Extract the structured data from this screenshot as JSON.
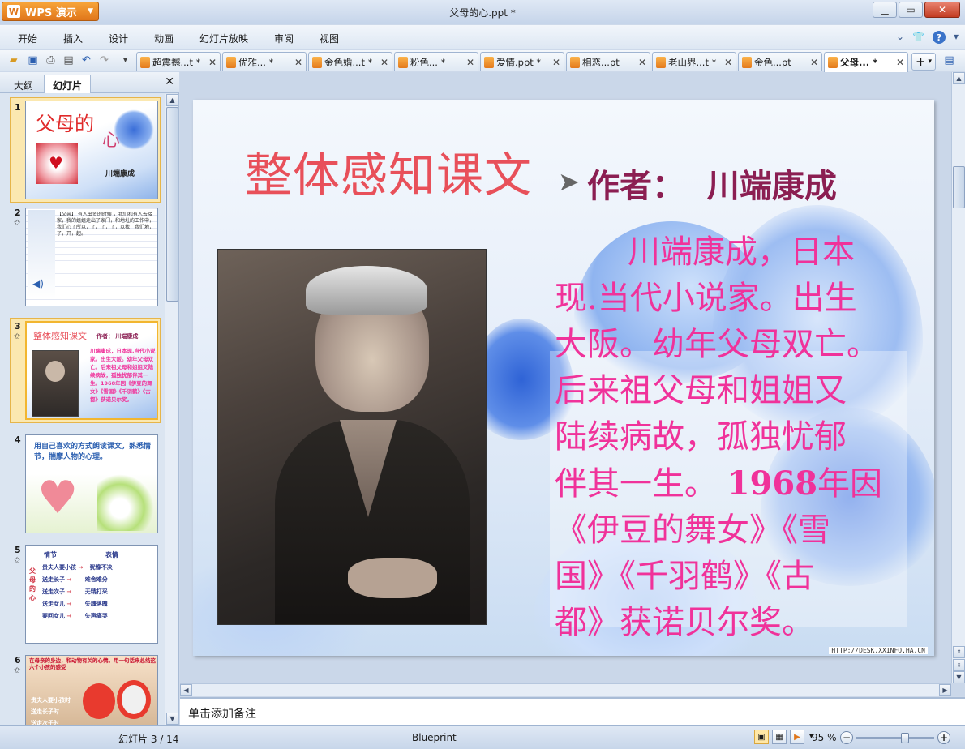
{
  "app": {
    "button_label": "WPS 演示",
    "logo_letter": "W",
    "window_title": "父母的心.ppt *"
  },
  "window_controls": {
    "minimize": "▭",
    "maximize": "▢",
    "close": "✕"
  },
  "menu": {
    "items": [
      "开始",
      "插入",
      "设计",
      "动画",
      "幻灯片放映",
      "审阅",
      "视图"
    ]
  },
  "tabs": [
    {
      "label": "超震撼...t *"
    },
    {
      "label": "优雅... *"
    },
    {
      "label": "金色婚...t *"
    },
    {
      "label": "粉色... *"
    },
    {
      "label": "爱情.ppt *"
    },
    {
      "label": "相恋...pt"
    },
    {
      "label": "老山界...t *"
    },
    {
      "label": "金色...pt"
    },
    {
      "label": "父母... *"
    }
  ],
  "left_panel": {
    "tab_outline": "大纲",
    "tab_slides": "幻灯片",
    "thumbnails": [
      {
        "num": "1",
        "title": "父母的",
        "extra": "心",
        "sub": "川端康成"
      },
      {
        "num": "2",
        "text": "【父亲】 有人出资的时候 ，我们和有人去接家，我的姐姐走出了家门，和地址的工作中，我们心了所以，了，了，了，以找，我们地，了，开，起。"
      },
      {
        "num": "3",
        "title": "整体感知课文",
        "author": "作者： 川端康成",
        "body": "川端康成，日本现.当代小说家。出生大阪。幼年父母双亡。后来祖父母和姐姐又陆续病故，孤独忧郁伴其一生。1968年因《伊豆的舞女》《雪国》《千羽鹤》《古都》获诺贝尔奖。"
      },
      {
        "num": "4",
        "text": "用自己喜欢的方式朗读课文，熟悉情节，揣摩人物的心理。"
      },
      {
        "num": "5",
        "col1": "情节",
        "col2": "表情",
        "side": "父母的心",
        "rows": [
          {
            "a": "贵夫人要小孩",
            "b": "犹豫不决"
          },
          {
            "a": "送走长子",
            "b": "难舍难分"
          },
          {
            "a": "送走次子",
            "b": "无精打采"
          },
          {
            "a": "送走女儿",
            "b": "失魂落魄"
          },
          {
            "a": "要回女儿",
            "b": "失声痛哭"
          }
        ]
      },
      {
        "num": "6",
        "text": "在母亲的身边，和动物有关的心情。用一句话来总结这六个小孩的感受",
        "rows": [
          "贵夫人要小孩时",
          "送走长子时",
          "送走次子时"
        ]
      }
    ]
  },
  "slide": {
    "title": "整体感知课文",
    "author_line": "作者：  川端康成",
    "body_line1": "川端康成，日本",
    "body_lines": [
      "现.当代小说家。出生",
      "大阪。幼年父母双亡。",
      "后来祖父母和姐姐又",
      "陆续病故，孤独忧郁"
    ],
    "body_year_pre": "伴其一生。",
    "body_year": "1968",
    "body_year_post": "年因",
    "body_tail": [
      "《伊豆的舞女》《雪",
      "国》《千羽鹤》《古",
      "都》获诺贝尔奖。"
    ],
    "watermark": "HTTP://DESK.XXINFO.HA.CN"
  },
  "notes": {
    "placeholder": "单击添加备注"
  },
  "status": {
    "slide_counter": "幻灯片 3 / 14",
    "theme": "Blueprint",
    "zoom": "95 %",
    "zoom_fraction": 0.63
  },
  "colors": {
    "title_red": "#e8505a",
    "body_pink": "#f0329a",
    "author_maroon": "#8b1e52",
    "accent_orange": "#e0761a"
  }
}
